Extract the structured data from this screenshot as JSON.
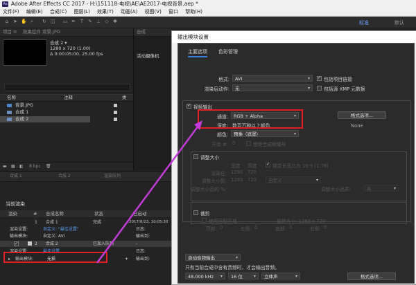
{
  "window": {
    "title": "Adobe After Effects CC 2017 - H:\\151118-电视\\AE\\AE2017-电视背景.aep *"
  },
  "menu": [
    "文件(F)",
    "编辑(E)",
    "合成(C)",
    "图层(L)",
    "效果(T)",
    "动画(A)",
    "视图(V)",
    "窗口",
    "帮助(H)"
  ],
  "toolbar": {
    "standard": "标准",
    "default": "默认"
  },
  "project": {
    "header": "项目 ≡",
    "header2": "效果控件 背景.JPG",
    "comp_name": "合成 2 ▾",
    "comp_res": "1280 x 720 (1.00)",
    "comp_dur": "Δ 0:00:05:00, 25.00 fps",
    "viewer_tab": "合成",
    "viewer_label": "活动摄像机",
    "col_name": "名称",
    "col_comment": "注释",
    "col_type": "类",
    "items": [
      {
        "name": "背景.JPG",
        "color": "#c8c8c8"
      },
      {
        "name": "合成 1",
        "color": "#c8c8c8"
      },
      {
        "name": "合成 2",
        "color": "#c8c8c8"
      }
    ],
    "bpc": "8 bpc"
  },
  "timeline": {
    "tabs": [
      "合成 1",
      "合成 2",
      "渲染队列"
    ],
    "rq_title": "当前渲染",
    "header": {
      "render": "渲染",
      "tag": "#",
      "comp": "合成名称",
      "status": "状态",
      "started": "已启动"
    },
    "row1": {
      "index": "1",
      "comp": "合成 1",
      "status": "完成",
      "started": "2017/8/23, 10:05:30"
    },
    "row1_settings_label": "渲染设置:",
    "row1_settings_value": "自定义: \"最佳设置\"",
    "row1_module_label": "输出模块:",
    "row1_module_value": "自定义: AVI",
    "row1_log": "日志:",
    "row1_output": "输出到:",
    "row2": {
      "index": "2",
      "comp": "合成 2",
      "status": "已加入队列",
      "started": "-"
    },
    "row2_settings_label": "渲染设置:",
    "row2_settings_value": "最佳设置",
    "row2_module_label": "输出模块:",
    "row2_module_value": "无损",
    "row2_log": "日志:",
    "row2_output": "输出到:"
  },
  "dialog": {
    "title": "输出模块设置",
    "tabs": [
      "主要选项",
      "色彩管理"
    ],
    "format_label": "格式:",
    "format_value": "AVI",
    "include_proj_link": "包括项目链接",
    "post_render_label": "渲染后动作:",
    "post_render_value": "无",
    "include_xmp": "包括源 XMP 元数据",
    "video_output": "视频输出",
    "channels_label": "通道:",
    "channels_value": "RGB + Alpha",
    "format_options": "格式选项...",
    "depth_label": "深度:",
    "depth_value": "数百万种以上颜色",
    "codec": "None",
    "color_label": "颜色:",
    "color_value": "预乘（遮罩）",
    "start_label": "开始 #:",
    "start_value": "0",
    "use_comp_frame": "使用合成帧编号",
    "resize": "调整大小",
    "resize_width": "宽度",
    "resize_height": "高度",
    "lock_ratio": "锁定长宽比为 16:9 (1.78)",
    "render_at_label": "渲染在:",
    "render_w": "1280",
    "render_h": "720",
    "resize_to_label": "调整大小到:",
    "resize_w": "1280",
    "resize_h": "720",
    "resize_preset": "自定义",
    "resize_pct_label": "调整大小后的 %:",
    "resize_quality_label": "调整大小品质:",
    "resize_quality_value": "高",
    "crop": "裁剪",
    "use_roi": "使用目标区域",
    "final_size": "最终大小: 1280 x 720",
    "crop_top_label": "顶部:",
    "crop_top": "0",
    "crop_left_label": "左侧:",
    "crop_left": "0",
    "crop_bottom_label": "底部:",
    "crop_bottom": "0",
    "crop_right_label": "右侧:",
    "crop_right": "0",
    "audio_auto": "自动音频输出",
    "audio_note": "只有当前合成中含有音频时，才会输出音频。",
    "audio_rate": "48.000 kHz",
    "audio_bits": "16 位",
    "audio_channels": "立体声",
    "audio_format_options": "格式选项..."
  },
  "annotation": {
    "box_color": "#e02020",
    "arrow_color": "#c23ad8"
  }
}
